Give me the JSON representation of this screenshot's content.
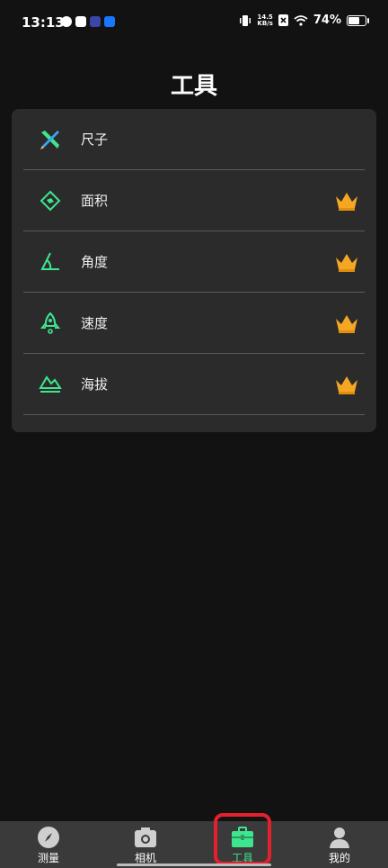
{
  "status_bar": {
    "time": "13:13",
    "speed_value": "14.5",
    "speed_unit": "KB/s",
    "battery": "74%",
    "battery_level": 0.74
  },
  "title": "工具",
  "tools": [
    {
      "label": "尺子",
      "icon": "ruler-pencil-icon",
      "premium": false
    },
    {
      "label": "面积",
      "icon": "area-diamond-icon",
      "premium": true
    },
    {
      "label": "角度",
      "icon": "angle-icon",
      "premium": true
    },
    {
      "label": "速度",
      "icon": "rocket-speed-icon",
      "premium": true
    },
    {
      "label": "海拔",
      "icon": "mountain-altitude-icon",
      "premium": true
    }
  ],
  "tabs": [
    {
      "label": "测量",
      "icon": "compass-icon",
      "active": false
    },
    {
      "label": "相机",
      "icon": "camera-icon",
      "active": false
    },
    {
      "label": "工具",
      "icon": "toolbox-icon",
      "active": true
    },
    {
      "label": "我的",
      "icon": "user-icon",
      "active": false
    }
  ],
  "colors": {
    "accent": "#3ee58f",
    "crown": "#f5a623",
    "highlight": "#e5202e",
    "card": "#2b2b2b",
    "background": "#121212"
  }
}
